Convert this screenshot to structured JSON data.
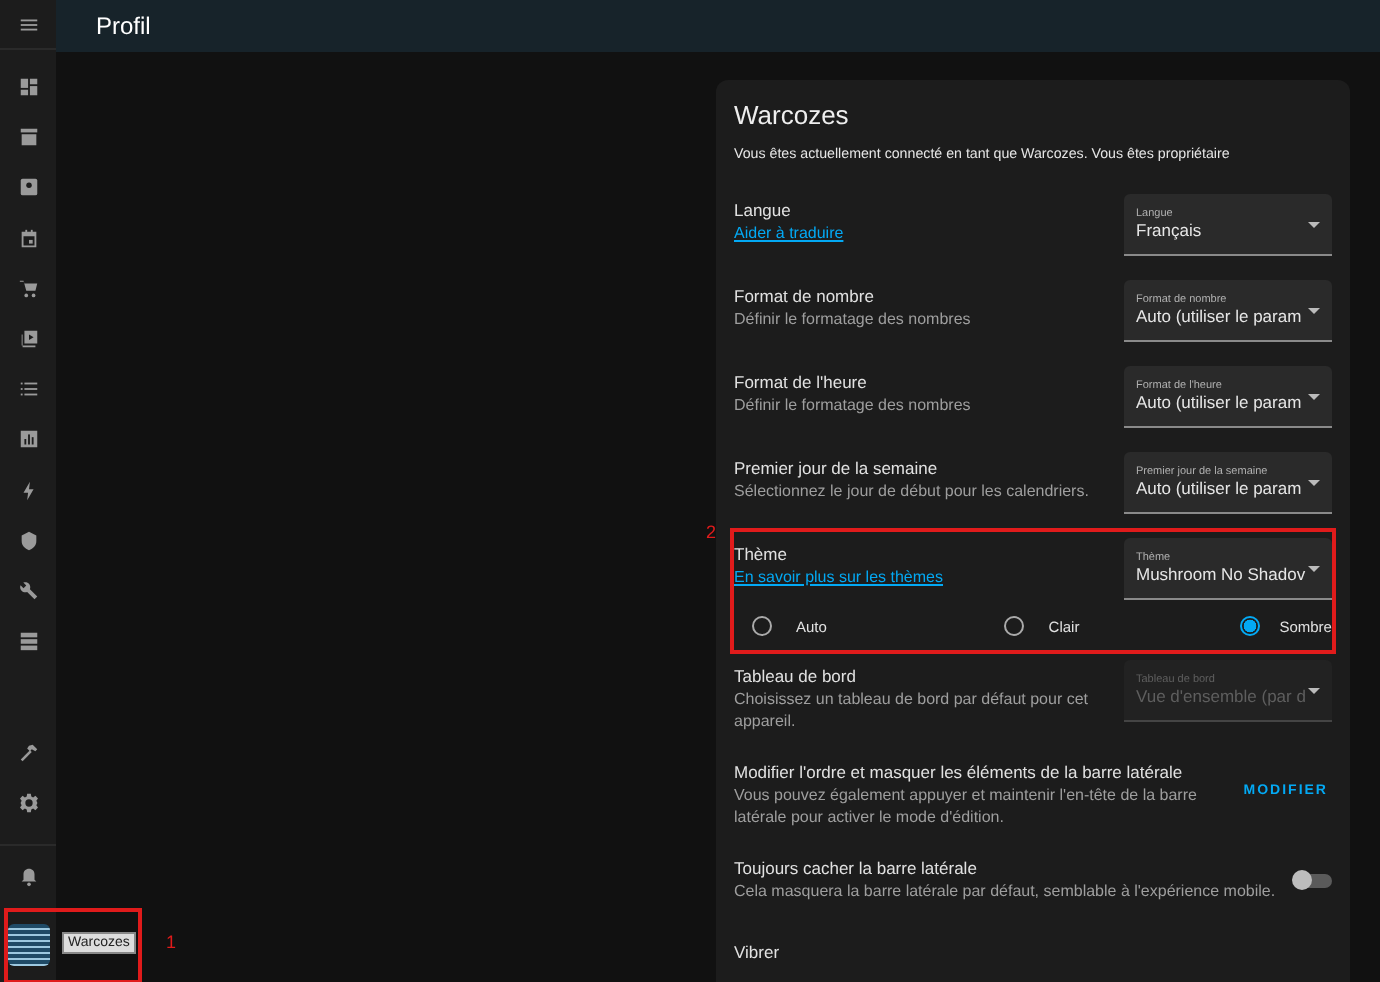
{
  "header": {
    "title": "Profil"
  },
  "sidebar": {
    "user": {
      "tooltip": "Warcozes",
      "annotation": "1"
    }
  },
  "card": {
    "title": "Warcozes",
    "intro": "Vous êtes actuellement connecté en tant que Warcozes. Vous êtes propriétaire",
    "settings": [
      {
        "kind": "select",
        "title": "Langue",
        "link": "Aider à traduire",
        "select": {
          "label": "Langue",
          "value": "Français",
          "disabled": false
        }
      },
      {
        "kind": "select",
        "title": "Format de nombre",
        "description": "Définir le formatage des nombres",
        "select": {
          "label": "Format de nombre",
          "value": "Auto (utiliser le param",
          "disabled": false
        }
      },
      {
        "kind": "select",
        "title": "Format de l'heure",
        "description": "Définir le formatage des nombres",
        "select": {
          "label": "Format de l'heure",
          "value": "Auto (utiliser le param",
          "disabled": false
        }
      },
      {
        "kind": "select",
        "title": "Premier jour de la semaine",
        "description": "Sélectionnez le jour de début pour les calendriers.",
        "select": {
          "label": "Premier jour de la semaine",
          "value": "Auto (utiliser le param",
          "disabled": false
        }
      },
      {
        "kind": "select",
        "title": "Thème",
        "link": "En savoir plus sur les thèmes",
        "annotation": "2",
        "select": {
          "label": "Thème",
          "value": "Mushroom No Shadov",
          "disabled": false
        },
        "radios": [
          {
            "label": "Auto",
            "selected": false
          },
          {
            "label": "Clair",
            "selected": false
          },
          {
            "label": "Sombre",
            "selected": true
          }
        ]
      },
      {
        "kind": "select",
        "title": "Tableau de bord",
        "description": "Choisissez un tableau de bord par défaut pour cet appareil.",
        "select": {
          "label": "Tableau de bord",
          "value": "Vue d'ensemble (par d",
          "disabled": true
        }
      },
      {
        "kind": "button",
        "title": "Modifier l'ordre et masquer les éléments de la barre latérale",
        "description": "Vous pouvez également appuyer et maintenir l'en-tête de la barre latérale pour activer le mode d'édition.",
        "button": "MODIFIER"
      },
      {
        "kind": "toggle",
        "title": "Toujours cacher la barre latérale",
        "description": "Cela masquera la barre latérale par défaut, semblable à l'expérience mobile.",
        "on": false
      },
      {
        "kind": "heading",
        "title": "Vibrer"
      }
    ]
  }
}
